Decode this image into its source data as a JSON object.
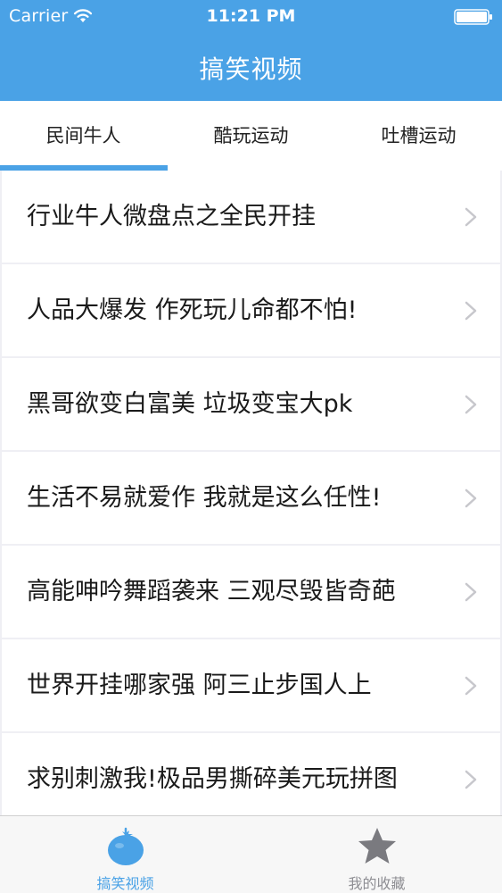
{
  "status_bar": {
    "carrier": "Carrier",
    "time": "11:21 PM"
  },
  "nav": {
    "title": "搞笑视频"
  },
  "tabs": [
    {
      "label": "民间牛人",
      "selected": true
    },
    {
      "label": "酷玩运动",
      "selected": false
    },
    {
      "label": "吐槽运动",
      "selected": false
    }
  ],
  "list": {
    "items": [
      {
        "title": "行业牛人微盘点之全民开挂"
      },
      {
        "title": "人品大爆发 作死玩儿命都不怕!"
      },
      {
        "title": "黑哥欲变白富美 垃圾变宝大pk"
      },
      {
        "title": "生活不易就爱作 我就是这么任性!"
      },
      {
        "title": "高能呻吟舞蹈袭来 三观尽毁皆奇葩"
      },
      {
        "title": "世界开挂哪家强 阿三止步国人上"
      },
      {
        "title": "求别刺激我!极品男撕碎美元玩拼图"
      }
    ]
  },
  "tabbar": {
    "items": [
      {
        "label": "搞笑视频",
        "icon": "tomato-icon",
        "selected": true
      },
      {
        "label": "我的收藏",
        "icon": "star-icon",
        "selected": false
      }
    ]
  },
  "colors": {
    "accent": "#4aa2e6",
    "inactive": "#8e8e93",
    "separator": "#d9d9d9"
  }
}
